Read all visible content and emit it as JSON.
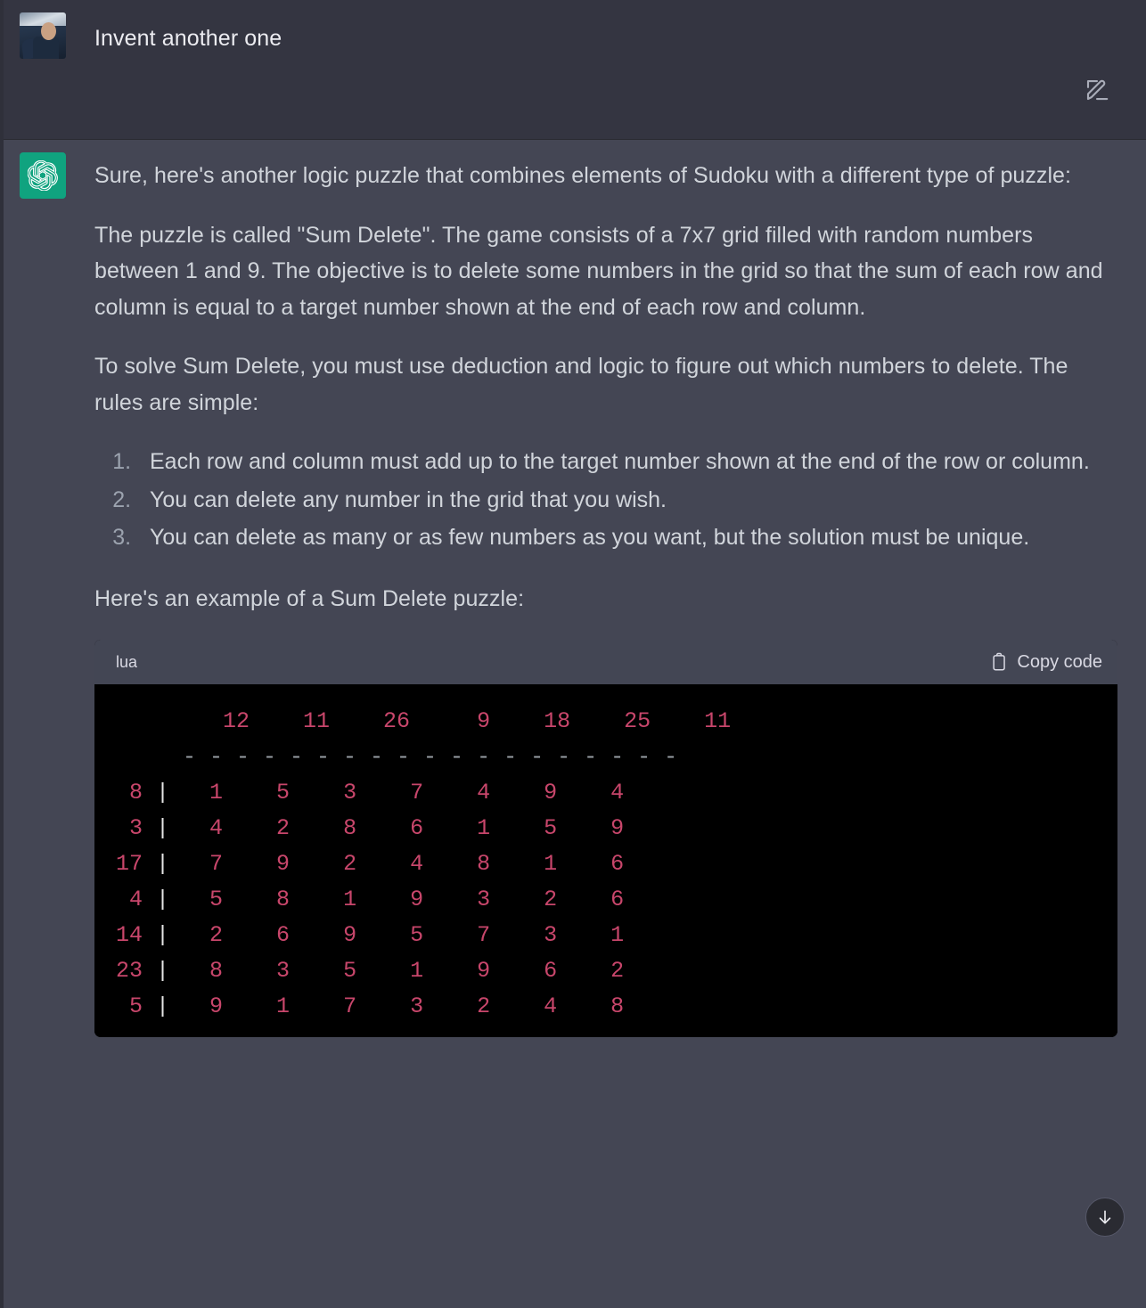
{
  "theme": {
    "user_row_bg": "#343541",
    "assistant_row_bg": "#444654",
    "text_color": "#d1d5db",
    "brand_green": "#10a37f",
    "code_bg": "#000000",
    "code_number_color": "#c8466b",
    "code_header_bg": "#434654"
  },
  "user_message": {
    "text": "Invent another one",
    "avatar_name": "user-avatar-photo"
  },
  "assistant_message": {
    "avatar_name": "chatgpt-logo",
    "paragraphs": [
      "Sure, here's another logic puzzle that combines elements of Sudoku with a different type of puzzle:",
      "The puzzle is called \"Sum Delete\". The game consists of a 7x7 grid filled with random numbers between 1 and 9. The objective is to delete some numbers in the grid so that the sum of each row and column is equal to a target number shown at the end of each row and column.",
      "To solve Sum Delete, you must use deduction and logic to figure out which numbers to delete. The rules are simple:"
    ],
    "rules": [
      "Each row and column must add up to the target number shown at the end of the row or column.",
      "You can delete any number in the grid that you wish.",
      "You can delete as many or as few numbers as you want, but the solution must be unique."
    ],
    "example_intro": "Here's an example of a Sum Delete puzzle:"
  },
  "code_block": {
    "language": "lua",
    "copy_label": "Copy code",
    "copy_icon": "clipboard-icon",
    "column_targets": [
      "12",
      "11",
      "26",
      "9",
      "18",
      "25",
      "11"
    ],
    "separator": "- - - - - - - - - - - - - - - - - - -",
    "row_separator_char": "|",
    "rows": [
      {
        "target": "8",
        "cells": [
          "1",
          "5",
          "3",
          "7",
          "4",
          "9",
          "4"
        ]
      },
      {
        "target": "3",
        "cells": [
          "4",
          "2",
          "8",
          "6",
          "1",
          "5",
          "9"
        ]
      },
      {
        "target": "17",
        "cells": [
          "7",
          "9",
          "2",
          "4",
          "8",
          "1",
          "6"
        ]
      },
      {
        "target": "4",
        "cells": [
          "5",
          "8",
          "1",
          "9",
          "3",
          "2",
          "6"
        ]
      },
      {
        "target": "14",
        "cells": [
          "2",
          "6",
          "9",
          "5",
          "7",
          "3",
          "1"
        ]
      },
      {
        "target": "23",
        "cells": [
          "8",
          "3",
          "5",
          "1",
          "9",
          "6",
          "2"
        ]
      },
      {
        "target": "5",
        "cells": [
          "9",
          "1",
          "7",
          "3",
          "2",
          "4",
          "8"
        ]
      }
    ]
  },
  "controls": {
    "edit_icon": "edit-pencil-square-icon",
    "scroll_to_bottom_icon": "arrow-down-icon"
  }
}
